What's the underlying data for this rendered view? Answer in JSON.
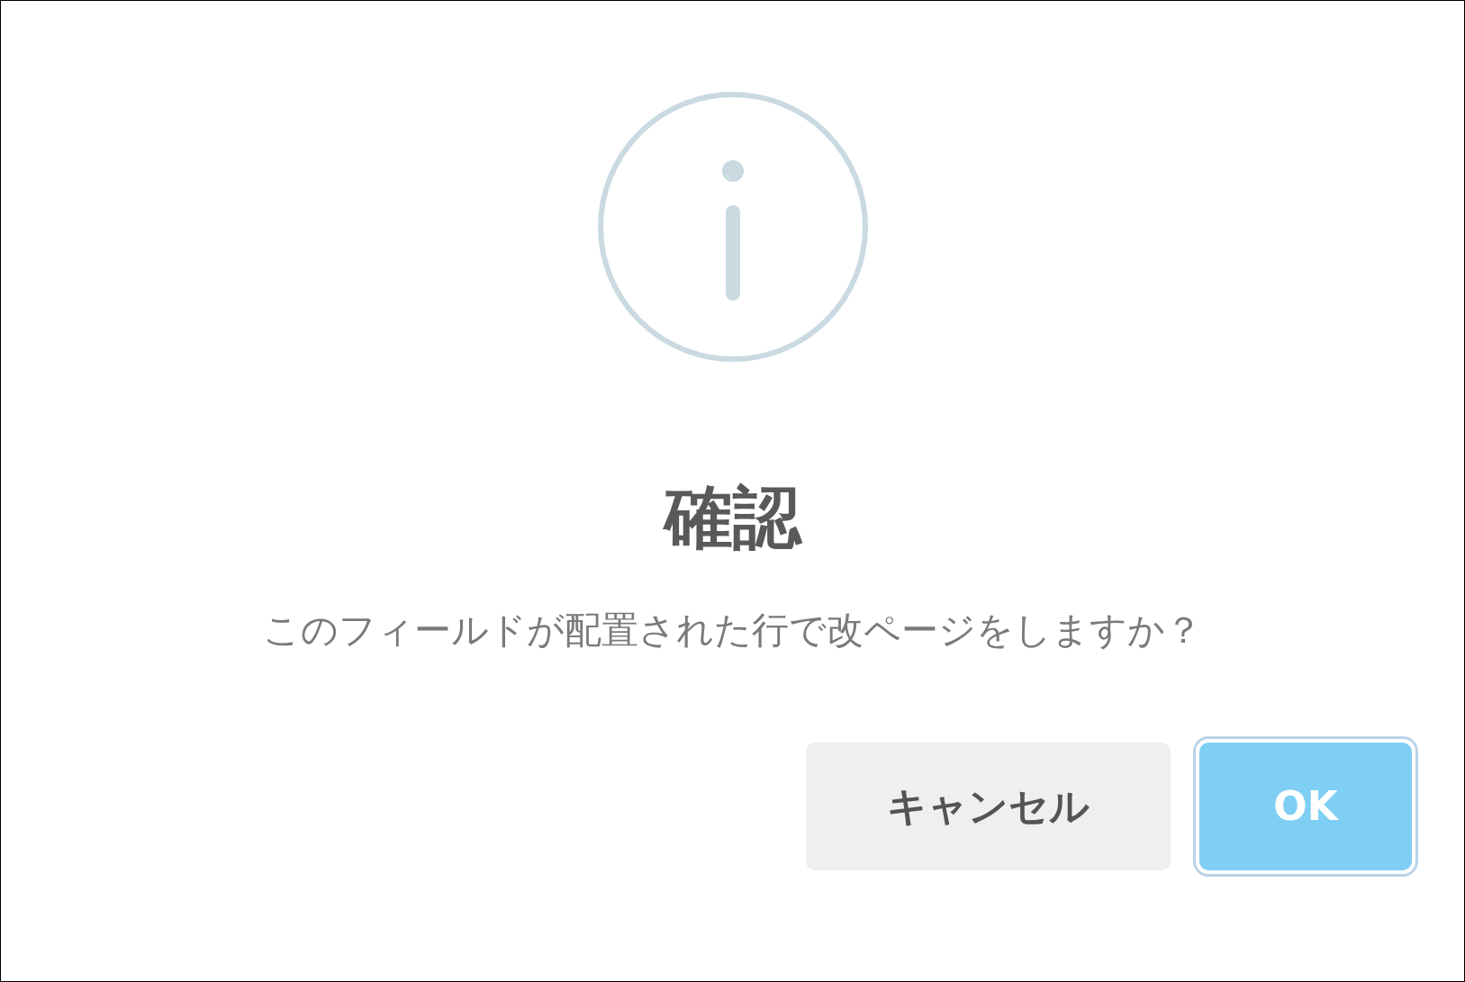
{
  "dialog": {
    "title": "確認",
    "message": "このフィールドが配置された行で改ページをしますか？",
    "buttons": [
      {
        "label": "キャンセル",
        "kind": "secondary",
        "focused": false
      },
      {
        "label": "OK",
        "kind": "primary",
        "focused": true
      }
    ]
  }
}
